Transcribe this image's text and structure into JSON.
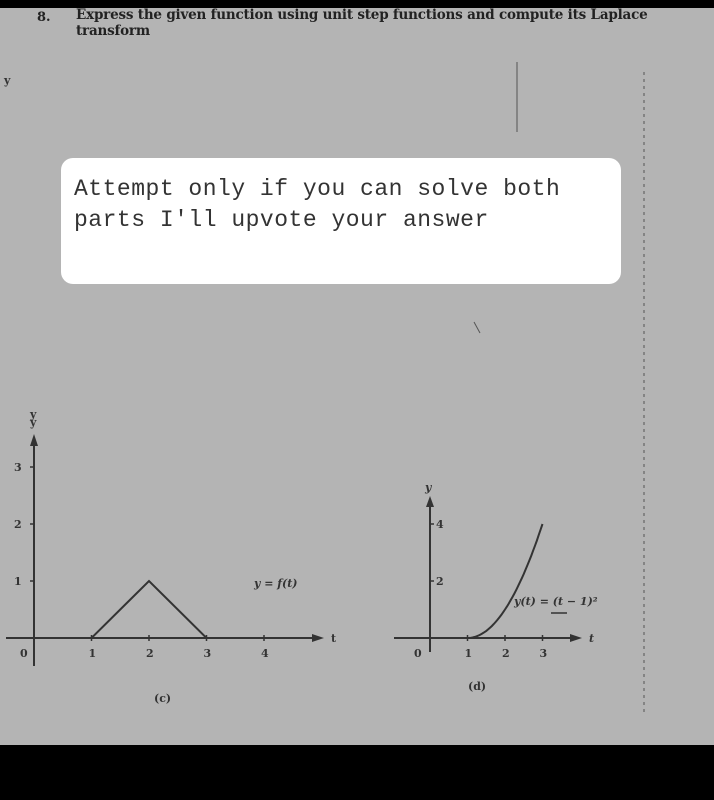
{
  "question": {
    "number": "8.",
    "text": "Express the given function using unit step functions and compute its Laplace transform"
  },
  "overlay_note": {
    "text": "Attempt only if you can solve both parts I'll upvote your answer",
    "color_bg": "#ffffff"
  },
  "colors": {
    "page_bg": "#b4b4b4",
    "ink": "#333333"
  },
  "margin_labels": {
    "top_left_y": "y",
    "mid_left_y": "y"
  },
  "chart_data": [
    {
      "id": "c",
      "type": "line",
      "caption": "(c)",
      "function_label": "y = f(t)",
      "xlabel": "t",
      "ylabel": "y",
      "origin_label": "0",
      "x_ticks": [
        "1",
        "2",
        "3",
        "4"
      ],
      "y_ticks": [
        "1",
        "2",
        "3"
      ],
      "xlim": [
        0,
        4.8
      ],
      "ylim": [
        0,
        3.5
      ],
      "points": [
        [
          0,
          0
        ],
        [
          1,
          0
        ],
        [
          2,
          1
        ],
        [
          3,
          0
        ],
        [
          4.8,
          0
        ]
      ]
    },
    {
      "id": "d",
      "type": "line",
      "caption": "(d)",
      "function_label": "y(t) = (t − 1)²",
      "xlabel": "t",
      "ylabel": "y",
      "origin_label": "0",
      "x_ticks": [
        "1",
        "2",
        "3"
      ],
      "y_ticks": [
        "2",
        "4"
      ],
      "xlim": [
        0,
        4.2
      ],
      "ylim": [
        0,
        4.8
      ],
      "piecewise": [
        {
          "domain": [
            0,
            1
          ],
          "expr": "0"
        },
        {
          "domain": [
            1,
            3
          ],
          "expr": "(t-1)^2"
        }
      ]
    }
  ]
}
